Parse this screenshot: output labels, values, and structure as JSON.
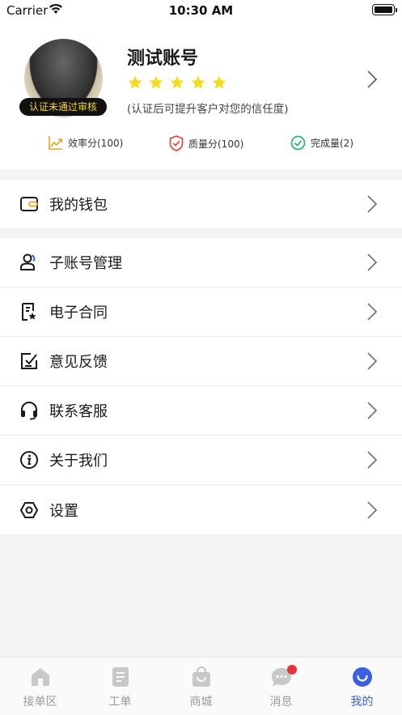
{
  "status_bar": {
    "carrier": "Carrier",
    "time": "10:30 AM"
  },
  "profile": {
    "nickname": "测试账号",
    "avatar_badge": "认证未通过审核",
    "rating_stars": 5,
    "cert_tip": "(认证后可提升客户对您的信任度)",
    "star_color": "#f5dc1c"
  },
  "metrics": [
    {
      "label": "效率分(100)",
      "icon": "trend-chart-icon",
      "color": "#f0a020"
    },
    {
      "label": "质量分(100)",
      "icon": "shield-check-icon",
      "color": "#e84040"
    },
    {
      "label": "完成量(2)",
      "icon": "check-circle-icon",
      "color": "#2ab36a"
    }
  ],
  "menu": {
    "wallet": {
      "label": "我的钱包",
      "icon": "wallet-icon"
    },
    "items": [
      {
        "label": "子账号管理",
        "icon": "sub-account-icon"
      },
      {
        "label": "电子合同",
        "icon": "contract-icon"
      },
      {
        "label": "意见反馈",
        "icon": "feedback-icon"
      },
      {
        "label": "联系客服",
        "icon": "headset-icon"
      },
      {
        "label": "关于我们",
        "icon": "info-icon"
      },
      {
        "label": "设置",
        "icon": "settings-icon"
      }
    ]
  },
  "tabs": [
    {
      "label": "接单区",
      "icon": "home-icon",
      "active": false
    },
    {
      "label": "工单",
      "icon": "document-icon",
      "active": false
    },
    {
      "label": "商城",
      "icon": "shopping-bag-icon",
      "active": false
    },
    {
      "label": "消息",
      "icon": "message-icon",
      "active": false,
      "unread": true
    },
    {
      "label": "我的",
      "icon": "profile-smile-icon",
      "active": true
    }
  ],
  "colors": {
    "accent": "#3a5fe0",
    "badge_text": "#f5d438",
    "unread_dot": "#e8333a"
  }
}
